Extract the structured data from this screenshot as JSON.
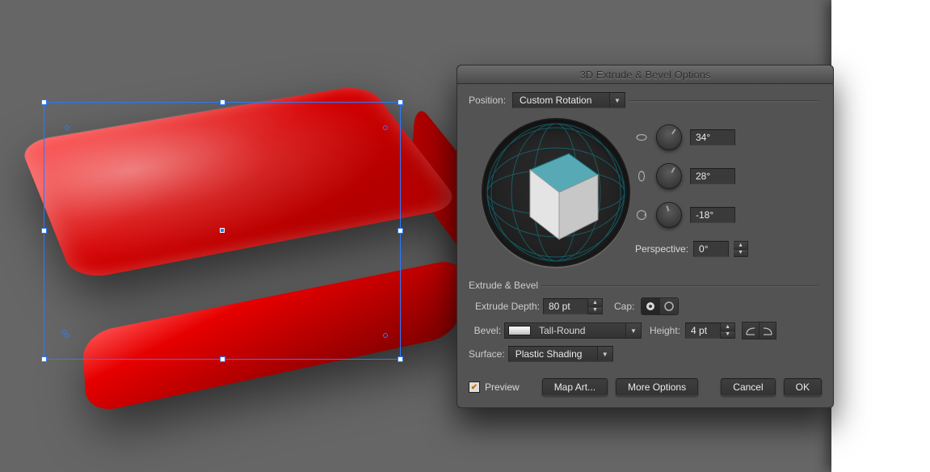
{
  "dialog": {
    "title": "3D Extrude & Bevel Options",
    "position_label": "Position:",
    "position_value": "Custom Rotation",
    "rotation": {
      "x": "34°",
      "y": "28°",
      "z": "-18°"
    },
    "perspective_label": "Perspective:",
    "perspective_value": "0°",
    "group_label": "Extrude & Bevel",
    "extrude_depth_label": "Extrude Depth:",
    "extrude_depth_value": "80 pt",
    "cap_label": "Cap:",
    "bevel_label": "Bevel:",
    "bevel_value": "Tall-Round",
    "height_label": "Height:",
    "height_value": "4 pt",
    "surface_label": "Surface:",
    "surface_value": "Plastic Shading",
    "preview_label": "Preview",
    "map_art_label": "Map Art...",
    "more_options_label": "More Options",
    "cancel_label": "Cancel",
    "ok_label": "OK"
  },
  "colors": {
    "object_fill": "#d40000",
    "object_highlight": "#ff3f3f",
    "object_shadow": "#700000",
    "selection": "#2a7aff",
    "accent_teal": "#4aa9b4"
  }
}
